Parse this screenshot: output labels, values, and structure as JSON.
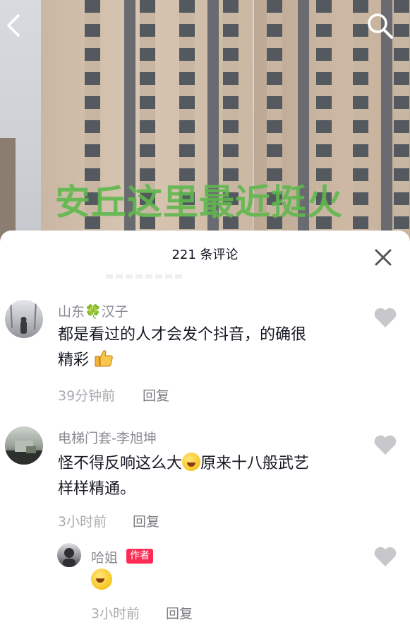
{
  "video": {
    "overlay_text": "安丘这里最近挺火"
  },
  "comments_header": {
    "count_label": "221 条评论"
  },
  "comments": [
    {
      "username": "山东🍀汉子",
      "text_part1": "都是看过的人才会发个抖音，的确很",
      "text_part2": "精彩",
      "emoji": "thumbs-up-emoji",
      "time": "39分钟前",
      "reply_label": "回复"
    },
    {
      "username": "电梯门套-李旭坤",
      "text_part1": "怪不得反响这么大",
      "text_part2": "原来十八般武艺",
      "text_part3": "样样精通。",
      "emoji": "rofl-emoji",
      "time": "3小时前",
      "reply_label": "回复"
    }
  ],
  "reply": {
    "username": "哈姐",
    "badge": "作者",
    "emoji": "rofl-emoji",
    "time": "3小时前",
    "reply_label": "回复"
  },
  "colors": {
    "overlay_green": "#5fb84e",
    "author_badge": "#fe2c55",
    "heart_gray": "#c8c8cc"
  }
}
